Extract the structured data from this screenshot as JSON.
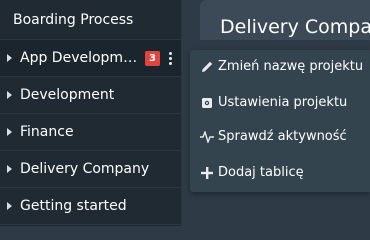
{
  "sidebar": {
    "header": "Boarding Process",
    "items": [
      {
        "label": "App Developm…",
        "badge": "3"
      },
      {
        "label": "Development"
      },
      {
        "label": "Finance"
      },
      {
        "label": "Delivery Company"
      },
      {
        "label": "Getting started"
      }
    ]
  },
  "main": {
    "title": "Delivery Compa"
  },
  "menu": {
    "items": [
      {
        "label": "Zmień nazwę projektu",
        "icon": "pencil-icon"
      },
      {
        "label": "Ustawienia projektu",
        "icon": "settings-icon"
      },
      {
        "label": "Sprawdź aktywność",
        "icon": "activity-icon"
      },
      {
        "label": "Dodaj tablicę",
        "icon": "plus-icon"
      }
    ]
  },
  "colors": {
    "sidebar_bg": "#1f2a33",
    "main_bg": "#2e3a45",
    "menu_bg": "#34444f",
    "badge": "#e0463f"
  }
}
